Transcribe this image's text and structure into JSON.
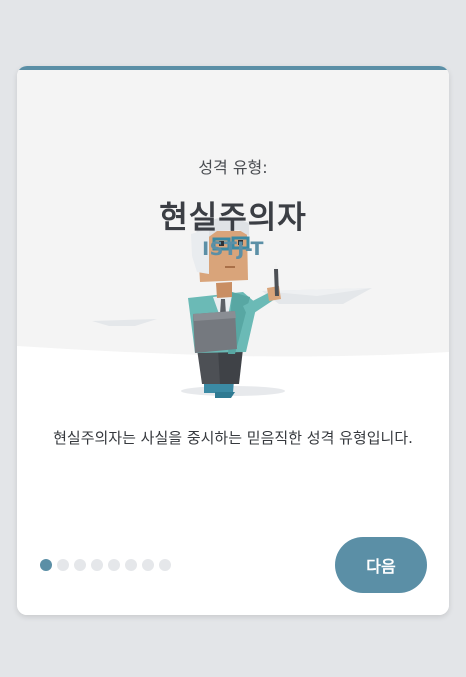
{
  "card": {
    "subtitle": "성격 유형:",
    "title": "현실주의자",
    "code": "ISTJ-T",
    "description": "현실주의자는 사실을 중시하는 믿음직한 성격 유형입니다."
  },
  "pagination": {
    "total": 8,
    "current": 1
  },
  "actions": {
    "next_label": "다음"
  },
  "colors": {
    "accent": "#5b8fa6",
    "background": "#e3e5e8",
    "card": "#ffffff"
  },
  "illustration": {
    "icon": "character-with-pen-and-book-icon"
  }
}
